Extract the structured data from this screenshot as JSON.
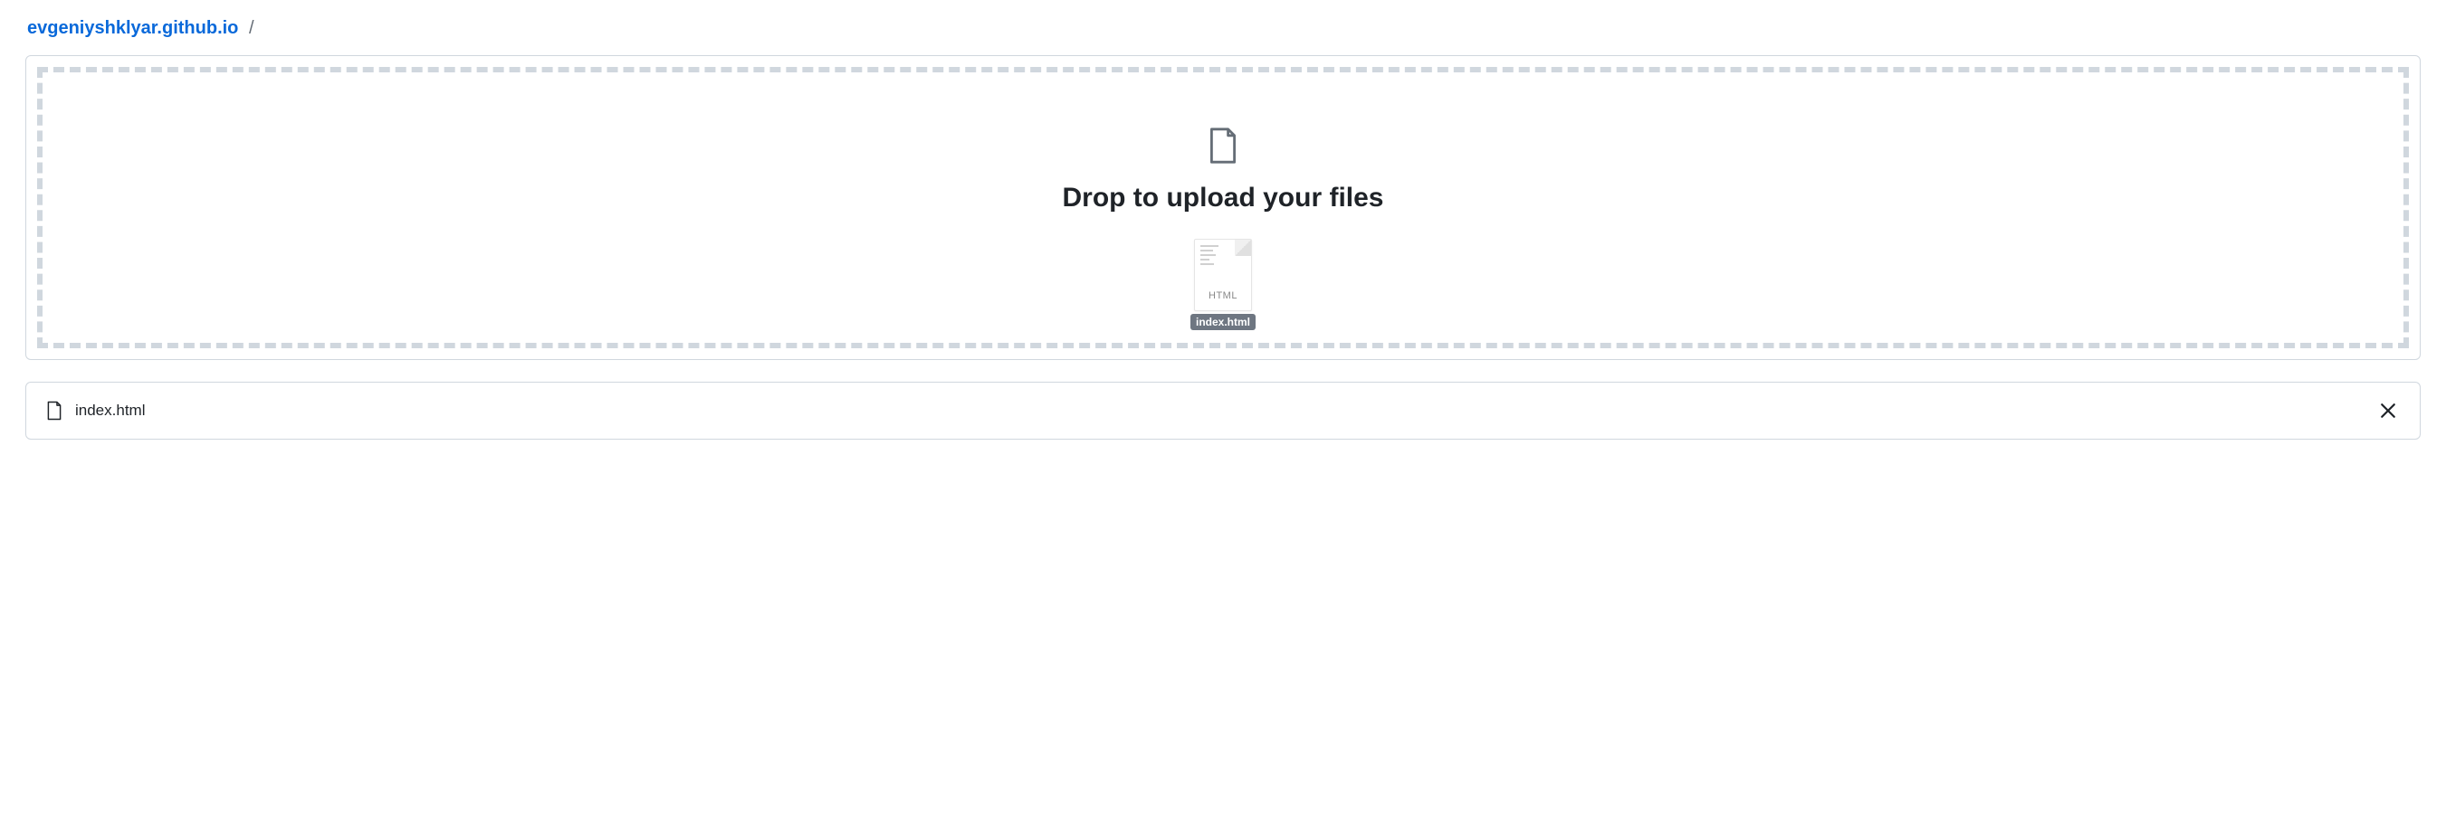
{
  "breadcrumb": {
    "repo": "evgeniyshklyar.github.io",
    "sep": "/"
  },
  "dropzone": {
    "message": "Drop to upload your files",
    "dragged_file": {
      "type_label": "HTML",
      "name": "index.html"
    }
  },
  "files": [
    {
      "name": "index.html"
    }
  ]
}
